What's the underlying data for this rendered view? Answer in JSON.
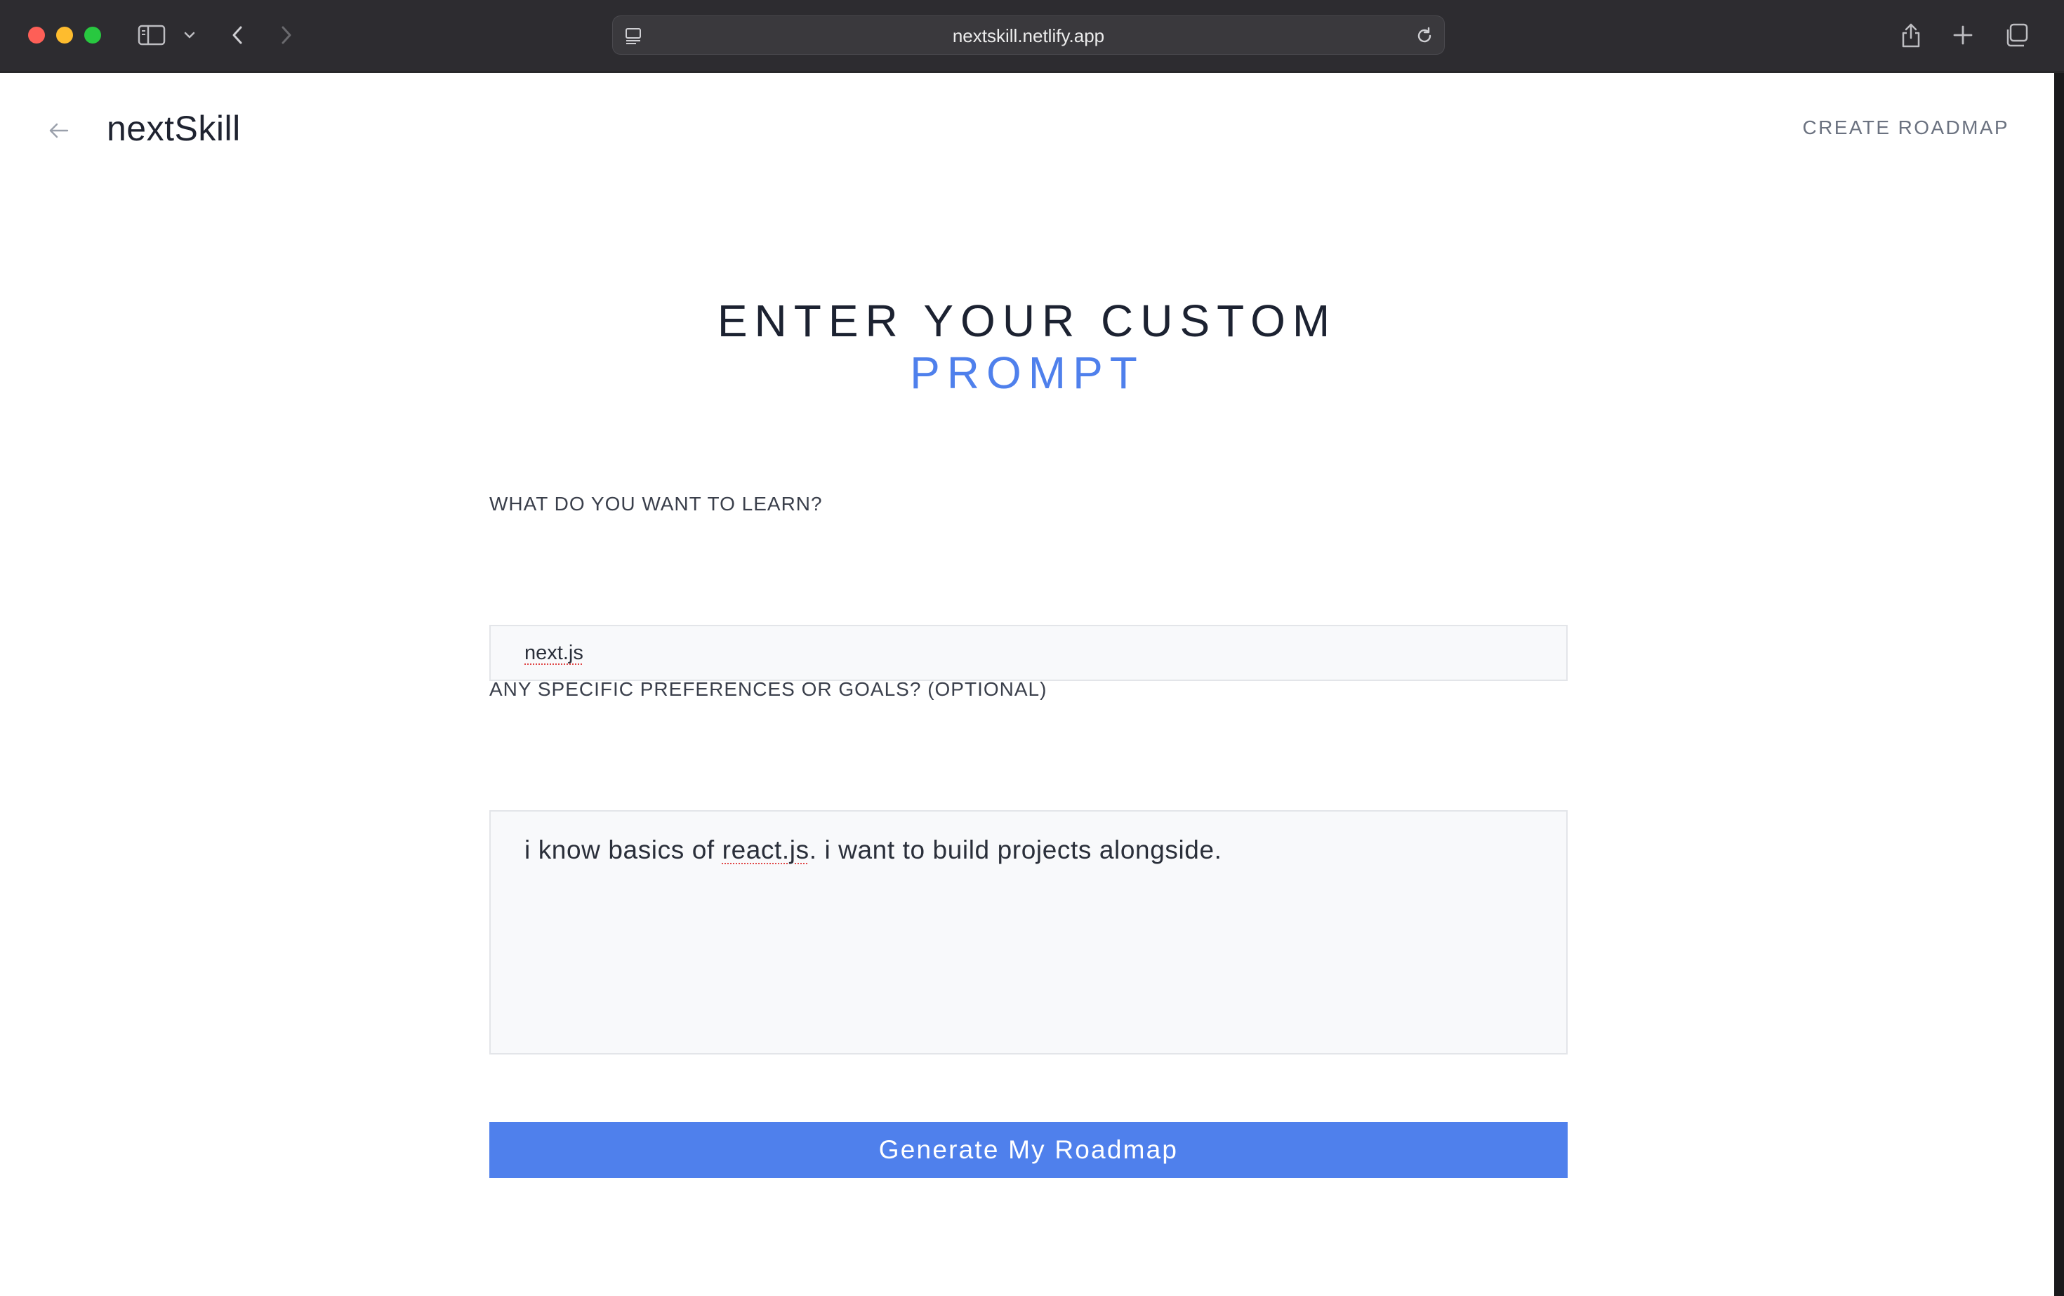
{
  "browser": {
    "url": "nextskill.netlify.app"
  },
  "header": {
    "brand": "nextSkill",
    "nav_link": "CREATE ROADMAP"
  },
  "main": {
    "heading_line1": "ENTER YOUR CUSTOM",
    "heading_line2": "PROMPT",
    "learn_label": "WHAT DO YOU WANT TO LEARN?",
    "learn_value": "next.js",
    "goals_label": "ANY SPECIFIC PREFERENCES OR GOALS? (OPTIONAL)",
    "goals_value_before": "i know basics of ",
    "goals_value_misspelled": "react.js",
    "goals_value_after": ". i want to build projects alongside.",
    "generate_button": "Generate My Roadmap"
  },
  "colors": {
    "accent": "#4f80ec",
    "heading_text": "#1c2231",
    "chrome_bg": "#2d2c30"
  }
}
